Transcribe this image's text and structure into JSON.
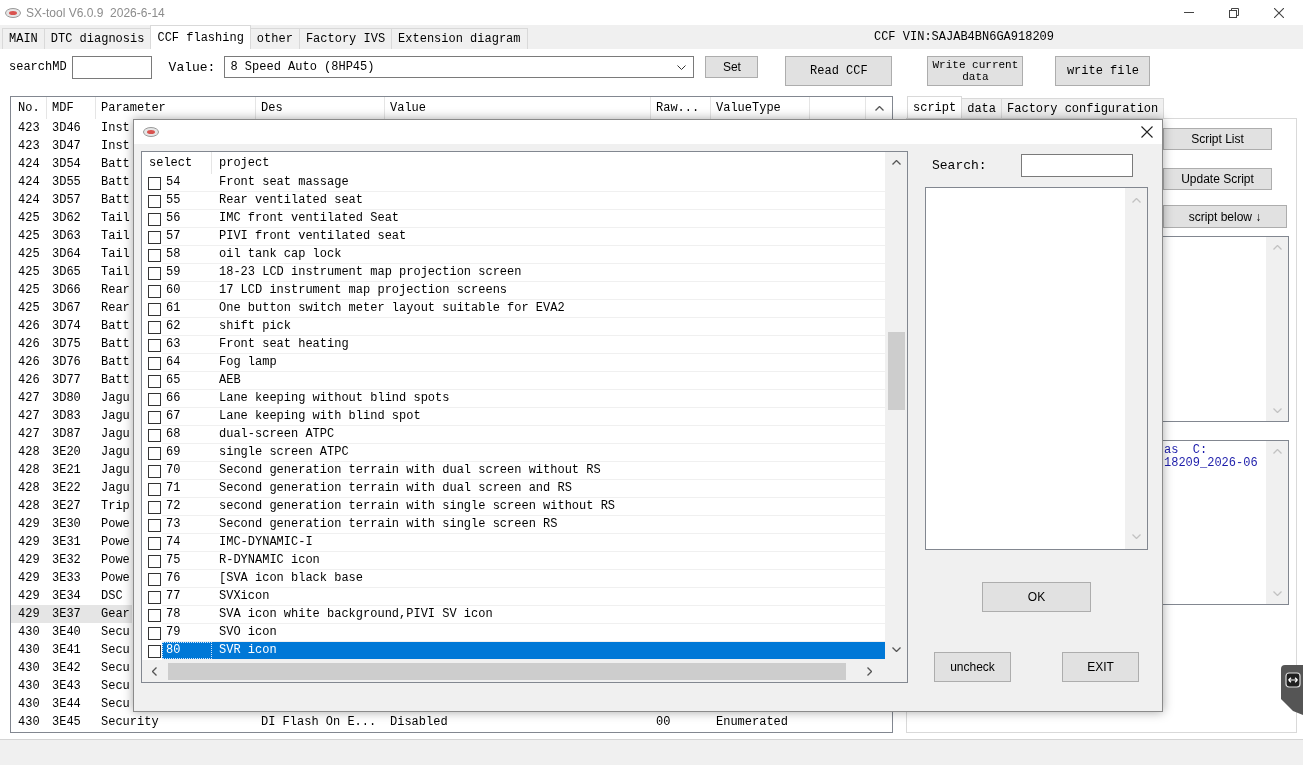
{
  "window": {
    "title": "SX-tool V6.0.9  2026-6-14"
  },
  "tabs": [
    {
      "label": "MAIN",
      "selected": false
    },
    {
      "label": "DTC diagnosis",
      "selected": false
    },
    {
      "label": "CCF flashing",
      "selected": true
    },
    {
      "label": "other",
      "selected": false
    },
    {
      "label": "Factory IVS",
      "selected": false
    },
    {
      "label": "Extension diagram",
      "selected": false
    }
  ],
  "vin_label": "CCF VIN:SAJAB4BN6GA918209",
  "toolbar": {
    "search_label": "searchMD",
    "value_label": "Value:",
    "value": "8 Speed Auto (8HP45)",
    "set_button": "Set",
    "action_buttons": [
      "Read CCF",
      "Write current data",
      "write file"
    ]
  },
  "parameter_table": {
    "columns": [
      "No.",
      "MDF",
      "Parameter",
      "Des",
      "Value",
      "Raw...",
      "ValueType"
    ],
    "rows": [
      {
        "cells": [
          "423",
          "3D46",
          "Inst"
        ],
        "selected": false
      },
      {
        "cells": [
          "423",
          "3D47",
          "Inst"
        ],
        "selected": false
      },
      {
        "cells": [
          "424",
          "3D54",
          "Batt"
        ],
        "selected": false
      },
      {
        "cells": [
          "424",
          "3D55",
          "Batt"
        ],
        "selected": false
      },
      {
        "cells": [
          "424",
          "3D57",
          "Batt"
        ],
        "selected": false
      },
      {
        "cells": [
          "425",
          "3D62",
          "Tail"
        ],
        "selected": false
      },
      {
        "cells": [
          "425",
          "3D63",
          "Tail"
        ],
        "selected": false
      },
      {
        "cells": [
          "425",
          "3D64",
          "Tail"
        ],
        "selected": false
      },
      {
        "cells": [
          "425",
          "3D65",
          "Tail"
        ],
        "selected": false
      },
      {
        "cells": [
          "425",
          "3D66",
          "Rear"
        ],
        "selected": false
      },
      {
        "cells": [
          "425",
          "3D67",
          "Rear"
        ],
        "selected": false
      },
      {
        "cells": [
          "426",
          "3D74",
          "Batt"
        ],
        "selected": false
      },
      {
        "cells": [
          "426",
          "3D75",
          "Batt"
        ],
        "selected": false
      },
      {
        "cells": [
          "426",
          "3D76",
          "Batt"
        ],
        "selected": false
      },
      {
        "cells": [
          "426",
          "3D77",
          "Batt"
        ],
        "selected": false
      },
      {
        "cells": [
          "427",
          "3D80",
          "Jagu"
        ],
        "selected": false
      },
      {
        "cells": [
          "427",
          "3D83",
          "Jagu"
        ],
        "selected": false
      },
      {
        "cells": [
          "427",
          "3D87",
          "Jagu"
        ],
        "selected": false
      },
      {
        "cells": [
          "428",
          "3E20",
          "Jagu"
        ],
        "selected": false
      },
      {
        "cells": [
          "428",
          "3E21",
          "Jagu"
        ],
        "selected": false
      },
      {
        "cells": [
          "428",
          "3E22",
          "Jagu"
        ],
        "selected": false
      },
      {
        "cells": [
          "428",
          "3E27",
          "Trip"
        ],
        "selected": false
      },
      {
        "cells": [
          "429",
          "3E30",
          "Powe"
        ],
        "selected": false
      },
      {
        "cells": [
          "429",
          "3E31",
          "Powe"
        ],
        "selected": false
      },
      {
        "cells": [
          "429",
          "3E32",
          "Powe"
        ],
        "selected": false
      },
      {
        "cells": [
          "429",
          "3E33",
          "Powe"
        ],
        "selected": false
      },
      {
        "cells": [
          "429",
          "3E34",
          "DSC"
        ],
        "selected": false
      },
      {
        "cells": [
          "429",
          "3E37",
          "Gear"
        ],
        "selected": true
      },
      {
        "cells": [
          "430",
          "3E40",
          "Secu"
        ],
        "selected": false
      },
      {
        "cells": [
          "430",
          "3E41",
          "Secu"
        ],
        "selected": false
      },
      {
        "cells": [
          "430",
          "3E42",
          "Secu"
        ],
        "selected": false
      },
      {
        "cells": [
          "430",
          "3E43",
          "Secu"
        ],
        "selected": false
      },
      {
        "cells": [
          "430",
          "3E44",
          "Secu"
        ],
        "selected": false
      },
      {
        "cells": [
          "430",
          "3E45",
          "Security",
          "DI Flash On E...",
          "Disabled",
          "00",
          "Enumerated"
        ],
        "selected": false
      }
    ]
  },
  "side_tabs": [
    {
      "label": "script",
      "selected": true
    },
    {
      "label": "data",
      "selected": false
    },
    {
      "label": "Factory configuration",
      "selected": false
    }
  ],
  "script_panel": {
    "buttons": [
      "Script List",
      "Update Script",
      "script below ↓"
    ],
    "log_lines": [
      "as  C:",
      "18209_2026-06"
    ]
  },
  "dialog": {
    "columns": [
      "select",
      "project"
    ],
    "items": [
      {
        "number": "54",
        "project": "Front seat massage",
        "checked": false,
        "selected": false
      },
      {
        "number": "55",
        "project": "Rear ventilated seat",
        "checked": false,
        "selected": false
      },
      {
        "number": "56",
        "project": "IMC front ventilated Seat",
        "checked": false,
        "selected": false
      },
      {
        "number": "57",
        "project": "PIVI front ventilated seat",
        "checked": false,
        "selected": false
      },
      {
        "number": "58",
        "project": "oil tank cap lock",
        "checked": false,
        "selected": false
      },
      {
        "number": "59",
        "project": "18-23 LCD instrument map projection screen",
        "checked": false,
        "selected": false
      },
      {
        "number": "60",
        "project": "17 LCD instrument map projection screens",
        "checked": false,
        "selected": false
      },
      {
        "number": "61",
        "project": "One button switch meter layout suitable for EVA2",
        "checked": false,
        "selected": false
      },
      {
        "number": "62",
        "project": "shift pick",
        "checked": false,
        "selected": false
      },
      {
        "number": "63",
        "project": "Front seat heating",
        "checked": false,
        "selected": false
      },
      {
        "number": "64",
        "project": "Fog lamp",
        "checked": false,
        "selected": false
      },
      {
        "number": "65",
        "project": "AEB",
        "checked": false,
        "selected": false
      },
      {
        "number": "66",
        "project": "Lane keeping without blind spots",
        "checked": false,
        "selected": false
      },
      {
        "number": "67",
        "project": "Lane keeping with blind spot",
        "checked": false,
        "selected": false
      },
      {
        "number": "68",
        "project": "dual-screen ATPC",
        "checked": false,
        "selected": false
      },
      {
        "number": "69",
        "project": "single screen ATPC",
        "checked": false,
        "selected": false
      },
      {
        "number": "70",
        "project": "Second generation terrain with dual screen without RS",
        "checked": false,
        "selected": false
      },
      {
        "number": "71",
        "project": "Second generation terrain with dual screen and RS",
        "checked": false,
        "selected": false
      },
      {
        "number": "72",
        "project": "second generation terrain with single screen without RS",
        "checked": false,
        "selected": false
      },
      {
        "number": "73",
        "project": "Second generation terrain with single screen RS",
        "checked": false,
        "selected": false
      },
      {
        "number": "74",
        "project": "IMC-DYNAMIC-I",
        "checked": false,
        "selected": false
      },
      {
        "number": "75",
        "project": "R-DYNAMIC icon",
        "checked": false,
        "selected": false
      },
      {
        "number": "76",
        "project": "[SVA icon black base",
        "checked": false,
        "selected": false
      },
      {
        "number": "77",
        "project": "SVXicon",
        "checked": false,
        "selected": false
      },
      {
        "number": "78",
        "project": "SVA icon white background,PIVI SV icon",
        "checked": false,
        "selected": false
      },
      {
        "number": "79",
        "project": "SVO icon",
        "checked": false,
        "selected": false
      },
      {
        "number": "80",
        "project": "SVR icon",
        "checked": false,
        "selected": true
      }
    ],
    "search_label": "Search:",
    "ok_button": "OK",
    "uncheck_button": "uncheck",
    "exit_button": "EXIT"
  }
}
